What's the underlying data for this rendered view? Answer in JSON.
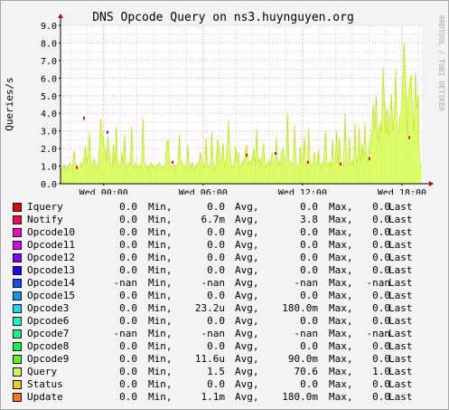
{
  "chart_data": {
    "type": "area",
    "title": "DNS Opcode Query on ns3.huynguyen.org",
    "ylabel": "Queries/s",
    "watermark": "RRDTOOL / TOBI OETIKER",
    "ylim": [
      0,
      9
    ],
    "y_ticks": [
      "0.0",
      "1.0",
      "2.0",
      "3.0",
      "4.0",
      "5.0",
      "6.0",
      "7.0",
      "8.0",
      "9.0"
    ],
    "x_ticks": [
      "Wed 00:00",
      "Wed 06:00",
      "Wed 12:00",
      "Wed 18:00"
    ],
    "x_tick_hours": [
      3,
      9,
      15,
      21
    ],
    "x_range_hours": [
      0.4,
      22.2
    ],
    "grid": true,
    "series_color": "#ccff33",
    "fill_color": "#f3ffc4",
    "query_samples": [
      0.9,
      0.8,
      1.1,
      0.7,
      1.0,
      0.9,
      1.2,
      0.8,
      1.0,
      1.9,
      1.1,
      0.9,
      0.8,
      1.0,
      1.2,
      0.9,
      1.5,
      2.1,
      1.0,
      1.7,
      2.9,
      1.1,
      0.9,
      1.4,
      1.2,
      0.8,
      1.0,
      2.0,
      3.7,
      3.0,
      2.3,
      2.0,
      1.2,
      2.7,
      1.9,
      1.1,
      0.9,
      2.2,
      1.0,
      3.2,
      1.3,
      1.0,
      0.9,
      1.8,
      1.1,
      2.8,
      1.0,
      0.9,
      1.2,
      1.1,
      3.3,
      1.0,
      0.8,
      1.2,
      0.9,
      1.0,
      1.1,
      0.8,
      3.7,
      1.2,
      0.9,
      1.0,
      0.8,
      1.1,
      1.2,
      0.9,
      1.0,
      0.8,
      1.1,
      1.0,
      1.2,
      1.0,
      0.9,
      1.0,
      1.1,
      2.4,
      2.5,
      1.1,
      0.9,
      1.0,
      1.1,
      0.8,
      1.0,
      1.2,
      2.8,
      1.3,
      1.2,
      0.9,
      1.0,
      1.1,
      2.2,
      1.0,
      0.9,
      1.2,
      1.0,
      0.8,
      1.1,
      1.0,
      1.3,
      1.8,
      1.2,
      1.1,
      0.9,
      2.6,
      1.0,
      0.9,
      1.1,
      2.9,
      1.2,
      0.8,
      1.0,
      2.5,
      2.2,
      1.1,
      1.4,
      2.3,
      1.0,
      1.3,
      2.0,
      3.6,
      1.6,
      1.1,
      0.9,
      1.0,
      2.1,
      1.2,
      1.8,
      1.0,
      0.9,
      1.3,
      1.1,
      1.9,
      2.2,
      1.0,
      1.3,
      1.1,
      1.5,
      2.0,
      1.0,
      3.1,
      1.2,
      1.4,
      1.0,
      1.7,
      2.3,
      0.9,
      1.1,
      1.2,
      1.3,
      1.0,
      1.8,
      1.1,
      1.2,
      2.6,
      1.0,
      1.3,
      1.1,
      1.9,
      2.0,
      0.9,
      1.1,
      4.0,
      1.2,
      1.3,
      1.1,
      1.0,
      3.3,
      1.2,
      1.0,
      0.9,
      2.1,
      1.1,
      1.4,
      2.7,
      1.0,
      1.2,
      3.1,
      1.3,
      1.0,
      1.1,
      1.8,
      1.2,
      1.0,
      1.9,
      1.1,
      0.9,
      1.2,
      1.4,
      3.0,
      1.1,
      1.0,
      1.3,
      0.9,
      2.5,
      1.2,
      1.1,
      3.0,
      1.0,
      2.6,
      1.1,
      1.0,
      1.3,
      4.0,
      1.2,
      1.0,
      2.6,
      1.1,
      1.3,
      1.0,
      3.4,
      1.2,
      1.5,
      3.2,
      1.1,
      2.2,
      1.4,
      3.4,
      1.8,
      1.1,
      2.0,
      2.5,
      3.0,
      4.5,
      2.9,
      5.0,
      3.2,
      2.4,
      3.5,
      2.9,
      6.6,
      4.7,
      2.7,
      4.3,
      2.5,
      3.9,
      5.1,
      2.9,
      3.9,
      6.5,
      3.0,
      2.9,
      3.8,
      4.0,
      5.5,
      8.0,
      6.3,
      2.7,
      5.0,
      5.7,
      6.2,
      4.0,
      2.9,
      6.3,
      4.2,
      5.0,
      1.2,
      1.0
    ],
    "spikes": [
      {
        "at": 0.065,
        "value": 3.8,
        "color": "#ee0000"
      },
      {
        "at": 0.045,
        "value": 1.0,
        "color": "#ee0000"
      },
      {
        "at": 0.13,
        "value": 3.0,
        "color": "#8800aa"
      },
      {
        "at": 0.31,
        "value": 1.3,
        "color": "#ee0000"
      },
      {
        "at": 0.515,
        "value": 1.7,
        "color": "#ee0000"
      },
      {
        "at": 0.595,
        "value": 1.8,
        "color": "#cc0055"
      },
      {
        "at": 0.685,
        "value": 1.3,
        "color": "#ee0000"
      },
      {
        "at": 0.775,
        "value": 1.2,
        "color": "#ee0000"
      },
      {
        "at": 0.855,
        "value": 1.5,
        "color": "#ee0000"
      },
      {
        "at": 0.965,
        "value": 2.7,
        "color": "#ee0000"
      }
    ],
    "legend": [
      {
        "name": "Iquery",
        "color": "#ee0000",
        "min": "0.0",
        "avg": "0.0",
        "max": "0.0",
        "last": "0.0"
      },
      {
        "name": "Notify",
        "color": "#ff0066",
        "min": "0.0",
        "avg": "6.7m",
        "max": "3.8",
        "last": "0.0"
      },
      {
        "name": "Opcode10",
        "color": "#ff00cc",
        "min": "0.0",
        "avg": "0.0",
        "max": "0.0",
        "last": "0.0"
      },
      {
        "name": "Opcode11",
        "color": "#dd00ff",
        "min": "0.0",
        "avg": "0.0",
        "max": "0.0",
        "last": "0.0"
      },
      {
        "name": "Opcode12",
        "color": "#8800ff",
        "min": "0.0",
        "avg": "0.0",
        "max": "0.0",
        "last": "0.0"
      },
      {
        "name": "Opcode13",
        "color": "#2200ff",
        "min": "0.0",
        "avg": "0.0",
        "max": "0.0",
        "last": "0.0"
      },
      {
        "name": "Opcode14",
        "color": "#0055ff",
        "min": "-nan",
        "avg": "-nan",
        "max": "-nan",
        "last": "-nan"
      },
      {
        "name": "Opcode15",
        "color": "#0099ff",
        "min": "0.0",
        "avg": "0.0",
        "max": "0.0",
        "last": "0.0"
      },
      {
        "name": "Opcode3",
        "color": "#00ddff",
        "min": "0.0",
        "avg": "23.2u",
        "max": "180.0m",
        "last": "0.0"
      },
      {
        "name": "Opcode6",
        "color": "#00ffcc",
        "min": "0.0",
        "avg": "0.0",
        "max": "0.0",
        "last": "0.0"
      },
      {
        "name": "Opcode7",
        "color": "#00ff88",
        "min": "-nan",
        "avg": "-nan",
        "max": "-nan",
        "last": "-nan"
      },
      {
        "name": "Opcode8",
        "color": "#00ff44",
        "min": "0.0",
        "avg": "0.0",
        "max": "0.0",
        "last": "0.0"
      },
      {
        "name": "Opcode9",
        "color": "#55ff00",
        "min": "0.0",
        "avg": "11.6u",
        "max": "90.0m",
        "last": "0.0"
      },
      {
        "name": "Query",
        "color": "#ccff33",
        "min": "0.0",
        "avg": "1.5",
        "max": "70.6",
        "last": "1.0"
      },
      {
        "name": "Status",
        "color": "#ffcc00",
        "min": "0.0",
        "avg": "0.0",
        "max": "0.0",
        "last": "0.0"
      },
      {
        "name": "Update",
        "color": "#ff7700",
        "min": "0.0",
        "avg": "1.1m",
        "max": "180.0m",
        "last": "0.0"
      }
    ],
    "stat_labels": {
      "min": "Min,",
      "avg": "Avg,",
      "max": "Max,",
      "last": "Last"
    }
  }
}
